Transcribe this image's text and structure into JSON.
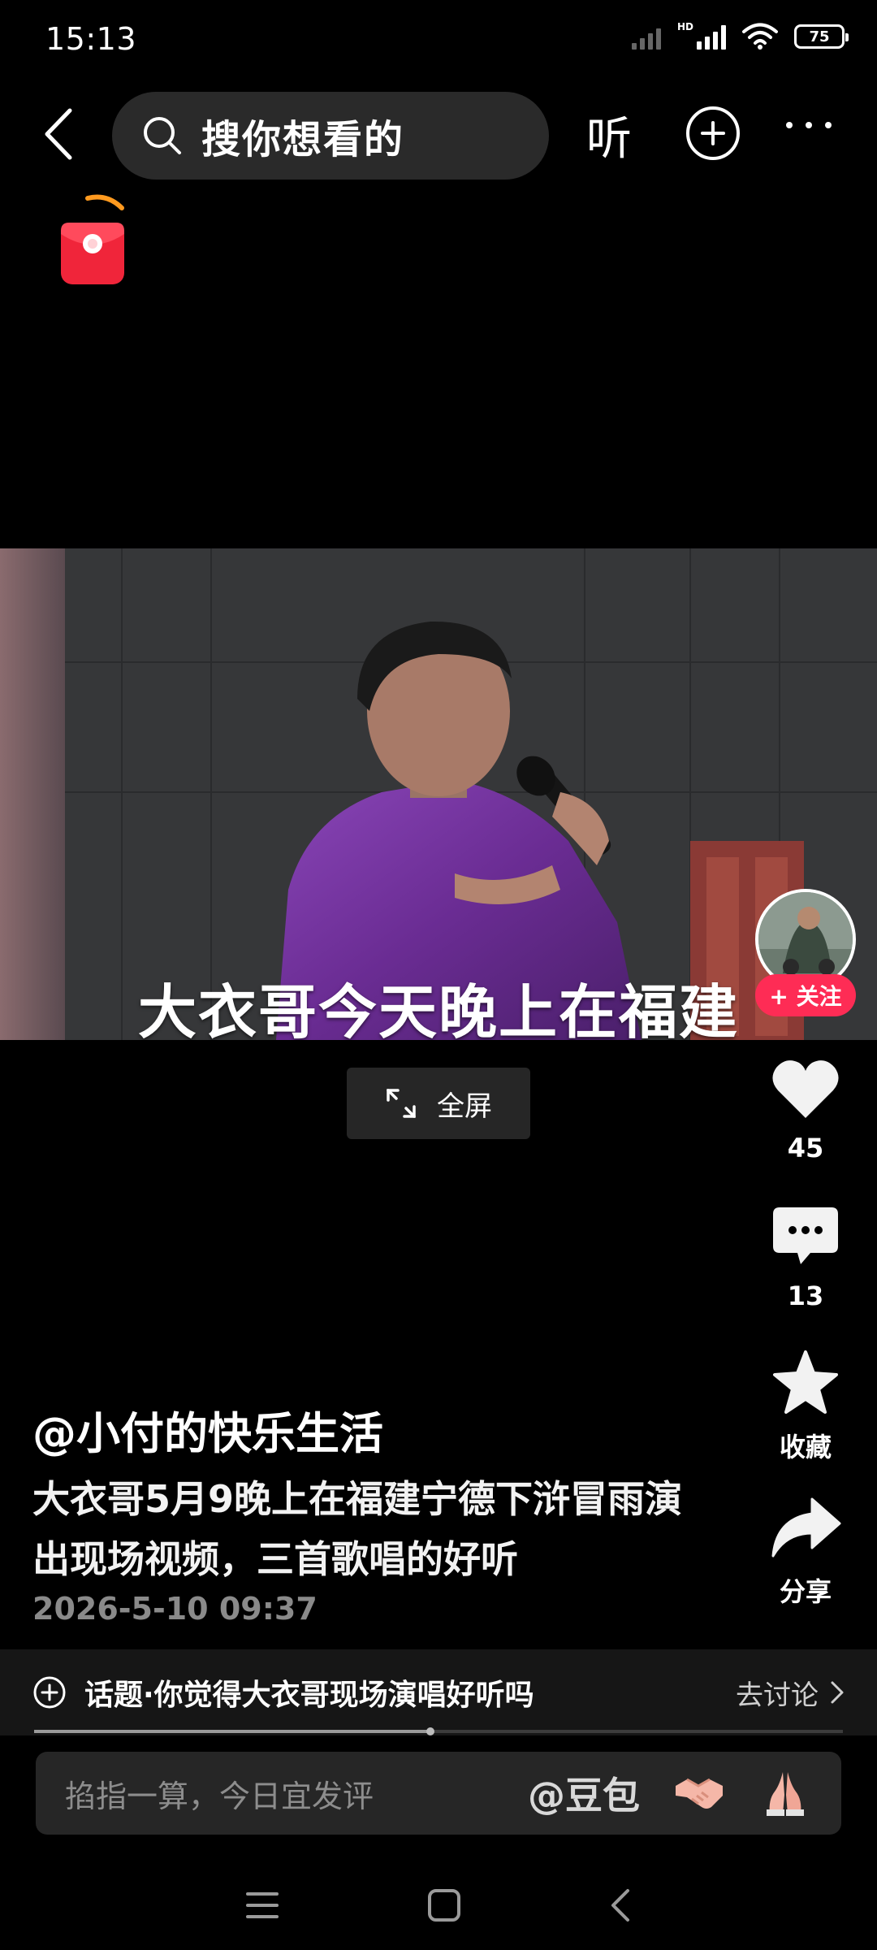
{
  "status_bar": {
    "time": "15:13",
    "network_tag": "HD",
    "battery": "75"
  },
  "top_nav": {
    "search_placeholder": "搜你想看的",
    "listen_label": "听"
  },
  "video": {
    "caption": "大衣哥今天晚上在福建"
  },
  "fullscreen": {
    "label": "全屏"
  },
  "side_actions": {
    "follow_label": "+ 关注",
    "like_count": "45",
    "comment_count": "13",
    "favorite_label": "收藏",
    "share_label": "分享"
  },
  "post": {
    "author": "@小付的快乐生活",
    "description": "大衣哥5月9晚上在福建宁德下浒冒雨演出现场视频，三首歌唱的好听",
    "date": "2026-5-10 09:37"
  },
  "topic": {
    "text": "话题·你觉得大衣哥现场演唱好听吗",
    "link": "去讨论"
  },
  "playback": {
    "progress": 0.49
  },
  "comment_bar": {
    "placeholder": "掐指一算，今日宜发评",
    "mention": "@豆包"
  },
  "colors": {
    "accent": "#fe2c55",
    "background": "#000000"
  }
}
